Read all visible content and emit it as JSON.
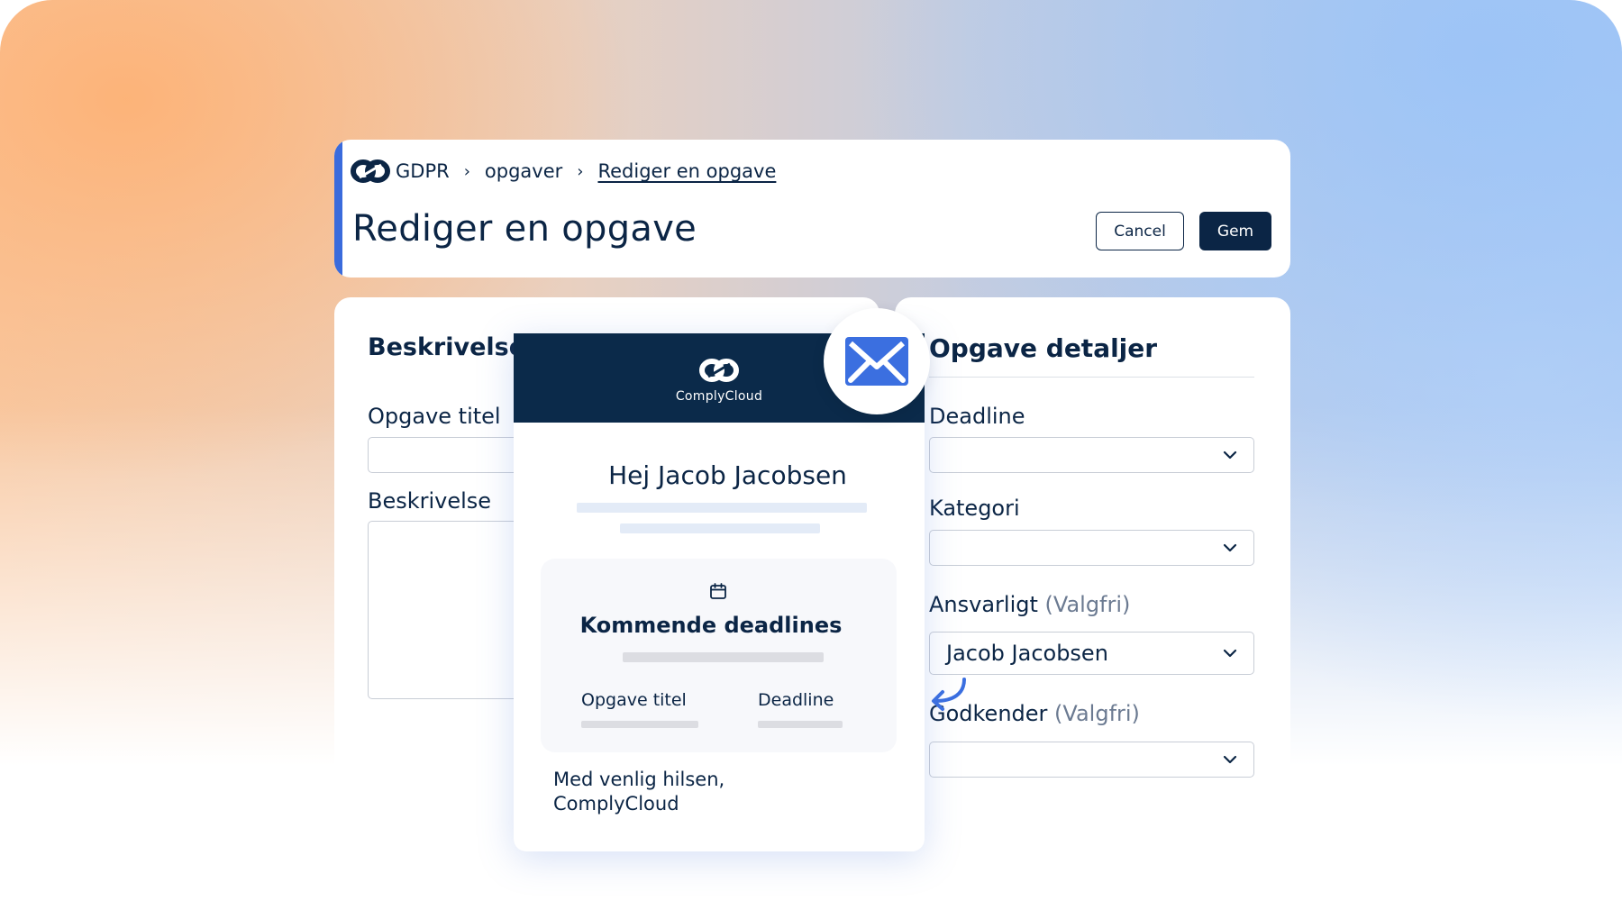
{
  "breadcrumb": {
    "root": "GDPR",
    "separator": "›",
    "level2": "opgaver",
    "current": "Rediger en opgave"
  },
  "header": {
    "title": "Rediger en opgave",
    "cancel_label": "Cancel",
    "save_label": "Gem"
  },
  "left_form": {
    "section_title": "Beskrivelse",
    "task_title_label": "Opgave titel",
    "task_title_value": "",
    "description_label": "Beskrivelse",
    "description_value": ""
  },
  "details": {
    "section_title": "Opgave detaljer",
    "deadline_label": "Deadline",
    "deadline_value": "",
    "category_label": "Kategori",
    "category_value": "",
    "responsible_label": "Ansvarligt",
    "responsible_optional": "(Valgfri)",
    "responsible_value": "Jacob Jacobsen",
    "approver_label": "Godkender",
    "approver_optional": "(Valgfri)",
    "approver_value": ""
  },
  "email": {
    "brand": "ComplyCloud",
    "greeting": "Hej Jacob Jacobsen",
    "box_title": "Kommende deadlines",
    "col_task": "Opgave titel",
    "col_deadline": "Deadline",
    "signoff_line1": "Med venlig hilsen,",
    "signoff_line2": "ComplyCloud"
  },
  "colors": {
    "navy": "#0b2545",
    "accent_blue": "#3a6bdc",
    "mail_blue": "#3b6fe0"
  },
  "icons": [
    "complycloud-logo-icon",
    "chevron-down-icon",
    "mail-icon",
    "calendar-icon",
    "curved-arrow-icon"
  ]
}
